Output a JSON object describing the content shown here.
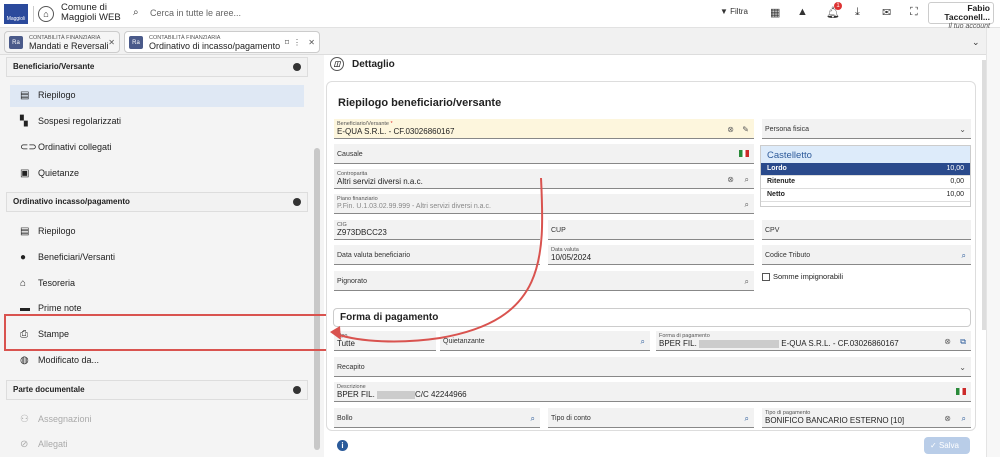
{
  "topbar": {
    "logo_text": "Maggioli",
    "app_title_line1": "Comune di",
    "app_title_line2": "Maggioli WEB",
    "search_placeholder": "Cerca in tutte le aree...",
    "filter_label": "Filtra",
    "notification_count": "1",
    "user_name": "Fabio Tacconell...",
    "user_role": "Il tuo account"
  },
  "tabs": [
    {
      "section": "CONTABILITÀ FINANZIARIA",
      "title": "Mandati e Reversali",
      "icon": "Ra"
    },
    {
      "section": "CONTABILITÀ FINANZIARIA",
      "title": "Ordinativo di incasso/pagamento",
      "icon": "Ra"
    }
  ],
  "sidebar": {
    "sections": [
      {
        "title": "Beneficiario/Versante",
        "items": [
          "Riepilogo",
          "Sospesi regolarizzati",
          "Ordinativi collegati",
          "Quietanze"
        ]
      },
      {
        "title": "Ordinativo incasso/pagamento",
        "items": [
          "Riepilogo",
          "Beneficiari/Versanti",
          "Tesoreria",
          "Prime note",
          "Stampe",
          "Modificato da..."
        ]
      },
      {
        "title": "Parte documentale",
        "items": [
          "Assegnazioni",
          "Allegati"
        ]
      }
    ]
  },
  "main": {
    "detail_title": "Dettaglio",
    "card_title": "Riepilogo beneficiario/versante",
    "fields": {
      "beneficiario_label": "Beneficiario/Versante",
      "beneficiario_value": "E-QUA S.R.L. - CF.03026860167",
      "persona_label": "Persona fisica",
      "causale_label": "Causale",
      "controp_label": "Controparita",
      "controp_value": "Altri servizi diversi n.a.c.",
      "piano_label": "Piano finanziario",
      "piano_value": "P.Fin. U.1.03.02.99.999 - Altri servizi diversi n.a.c.",
      "cig_label": "CIG",
      "cig_value": "Z973DBCC23",
      "cup_label": "CUP",
      "cpv_label": "CPV",
      "data_val_label": "Data valuta beneficiario",
      "data_valuta_label": "Data valuta",
      "data_valuta_value": "10/05/2024",
      "codice_tributo_label": "Codice Tributo",
      "pignorato_label": "Pignorato",
      "somme_label": "Somme impignorabili"
    },
    "castelletto": {
      "title": "Castelletto",
      "rows": [
        {
          "label": "Lordo",
          "value": "10,00"
        },
        {
          "label": "Ritenute",
          "value": "0,00"
        },
        {
          "label": "Netto",
          "value": "10,00"
        }
      ]
    },
    "forma": {
      "title": "Forma di pagamento",
      "tipo_label": "Tipo",
      "tipo_value": "Tutte",
      "quietanzante_label": "Quietanzante",
      "forma_label": "Forma di pagamento",
      "forma_value_a": "BPER FIL.",
      "forma_value_b": "E-QUA S.R.L. - CF.03026860167",
      "recapito_label": "Recapito",
      "descrizione_label": "Descrizione",
      "descrizione_value_a": "BPER FIL.",
      "descrizione_value_b": "C/C 42244966",
      "bollo_label": "Bollo",
      "tipo_conto_label": "Tipo di conto",
      "tipo_pag_label": "Tipo di pagamento",
      "tipo_pag_value": "BONIFICO BANCARIO ESTERNO [10]"
    },
    "save_label": "Salva"
  },
  "colors": {
    "highlight": "#d9534f",
    "primary": "#2a4a8c"
  }
}
